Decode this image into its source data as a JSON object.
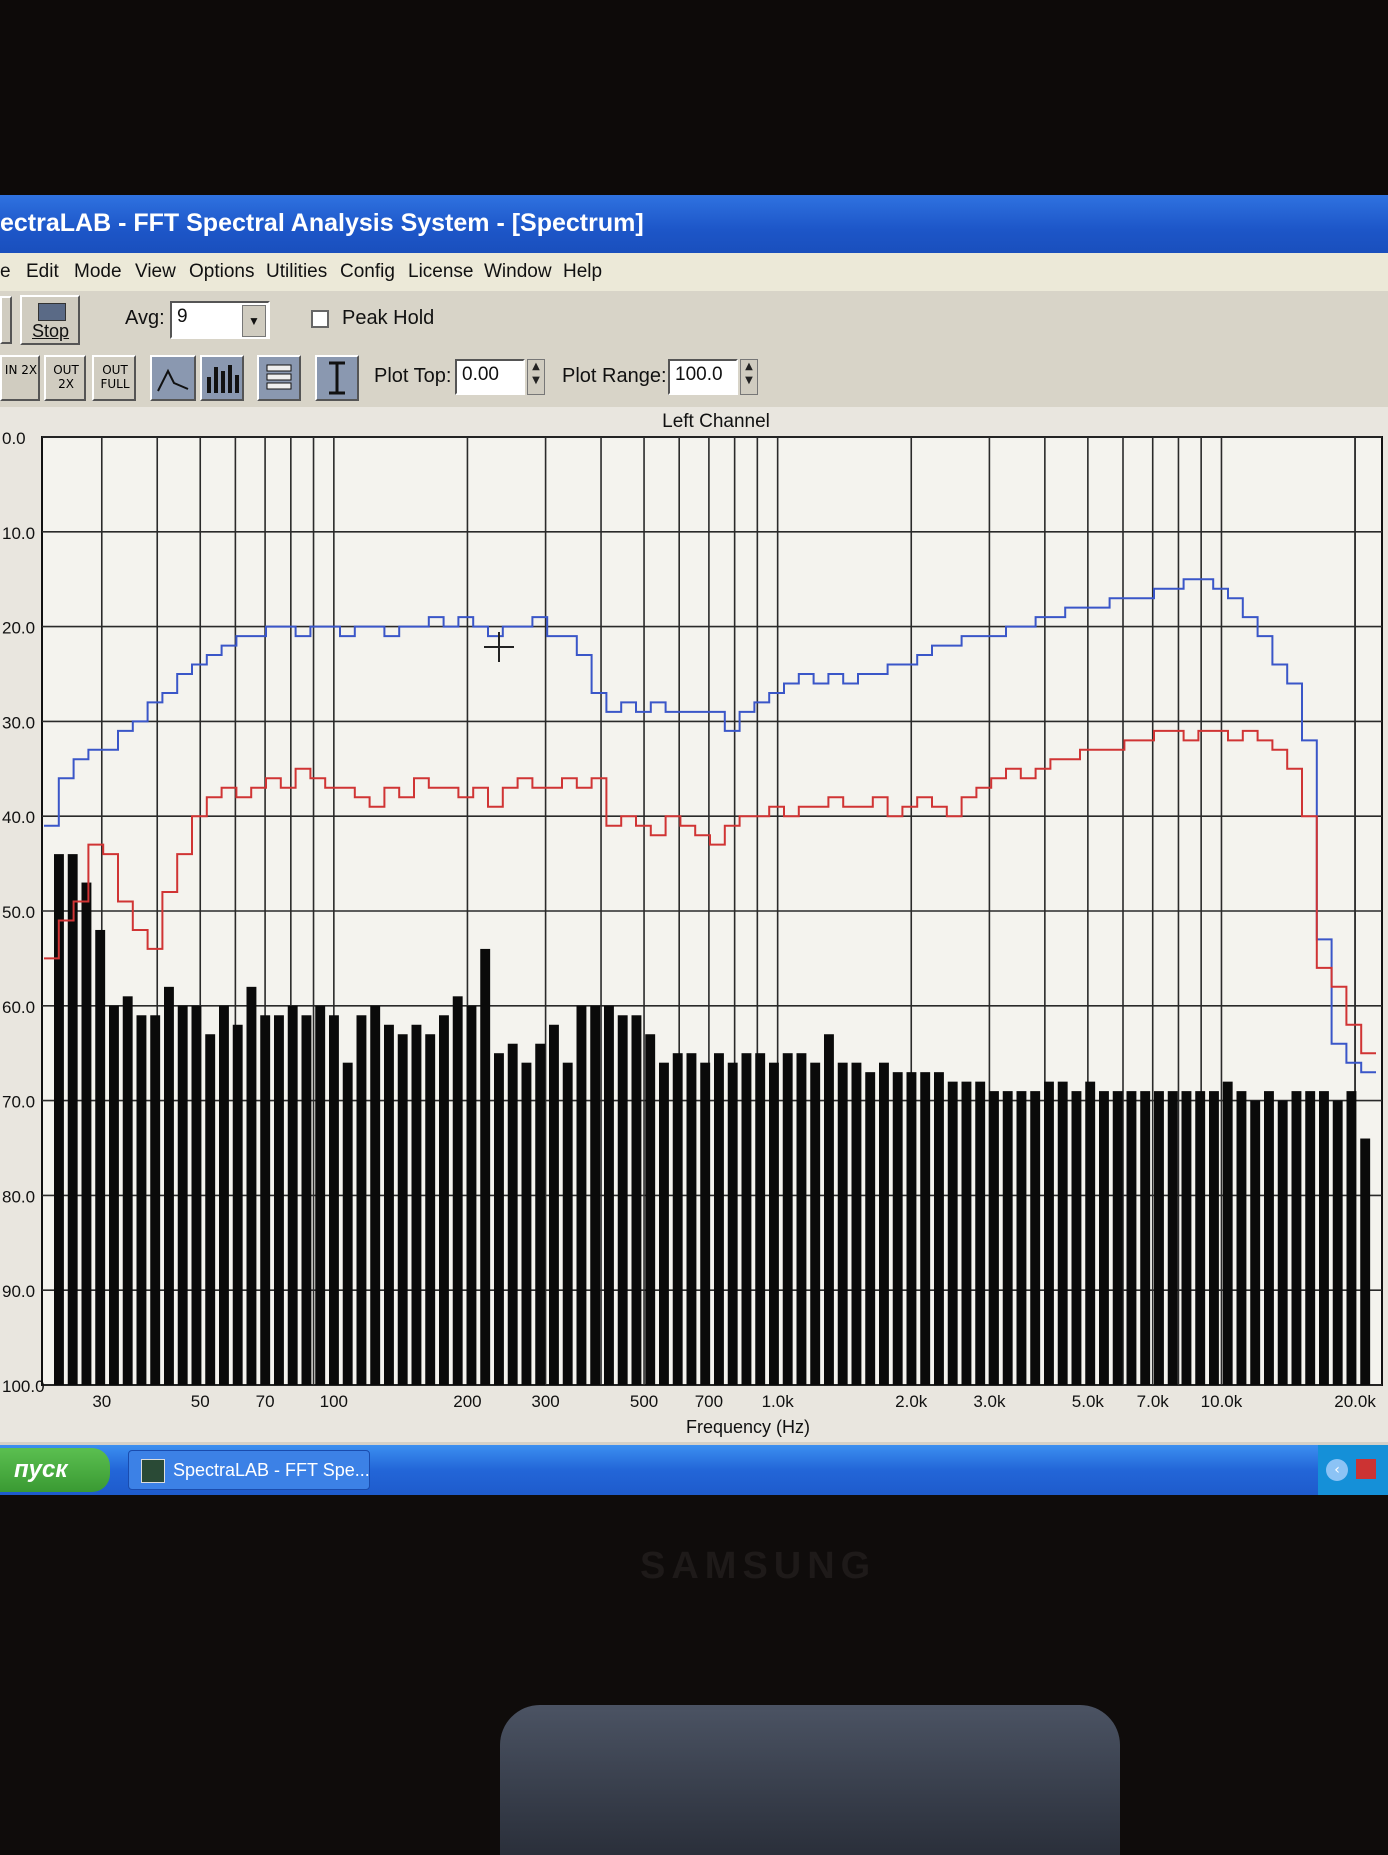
{
  "window": {
    "title": "ectraLAB - FFT Spectral Analysis System - [Spectrum]"
  },
  "menu": {
    "items": [
      "e",
      "Edit",
      "Mode",
      "View",
      "Options",
      "Utilities",
      "Config",
      "License",
      "Window",
      "Help"
    ]
  },
  "toolbar": {
    "stop_label": "Stop",
    "avg_label": "Avg:",
    "avg_value": "9",
    "peak_hold_label": "Peak Hold",
    "peak_hold_checked": false,
    "in_button": "IN 2X",
    "out2x_button": "OUT 2X",
    "outfull_button": "OUT FULL",
    "plot_top_label": "Plot Top:",
    "plot_top_value": "0.00",
    "plot_range_label": "Plot Range:",
    "plot_range_value": "100.0"
  },
  "taskbar": {
    "start_label": "пуск",
    "task_label": "SpectraLAB - FFT Spe..."
  },
  "monitor": {
    "brand": "SAMSUNG"
  },
  "chart_data": {
    "type": "bar",
    "title": "Left Channel",
    "xlabel": "Frequency (Hz)",
    "ylabel": "",
    "x_scale": "log",
    "xlim": [
      22,
      23000
    ],
    "ylim": [
      -100,
      0
    ],
    "y_tick_labels": [
      "0.0",
      "10.0",
      "20.0",
      "30.0",
      "40.0",
      "50.0",
      "60.0",
      "70.0",
      "80.0",
      "90.0",
      "100.0"
    ],
    "x_ticks": [
      {
        "value": 30,
        "label": "30"
      },
      {
        "value": 50,
        "label": "50"
      },
      {
        "value": 70,
        "label": "70"
      },
      {
        "value": 100,
        "label": "100"
      },
      {
        "value": 200,
        "label": "200"
      },
      {
        "value": 300,
        "label": "300"
      },
      {
        "value": 500,
        "label": "500"
      },
      {
        "value": 700,
        "label": "700"
      },
      {
        "value": 1000,
        "label": "1.0k"
      },
      {
        "value": 2000,
        "label": "2.0k"
      },
      {
        "value": 3000,
        "label": "3.0k"
      },
      {
        "value": 5000,
        "label": "5.0k"
      },
      {
        "value": 7000,
        "label": "7.0k"
      },
      {
        "value": 10000,
        "label": "10.0k"
      },
      {
        "value": 20000,
        "label": "20.0k"
      }
    ],
    "grid": true,
    "colors": {
      "bars": "#0a0a0a",
      "blue_line": "#3a56c8",
      "red_line": "#d03434",
      "background": "#f4f3ee",
      "grid": "#2a2a2a"
    },
    "bars": [
      -44,
      -44,
      -47,
      -52,
      -60,
      -59,
      -61,
      -61,
      -58,
      -60,
      -60,
      -63,
      -60,
      -62,
      -58,
      -61,
      -61,
      -60,
      -61,
      -60,
      -61,
      -66,
      -61,
      -60,
      -62,
      -63,
      -62,
      -63,
      -61,
      -59,
      -60,
      -54,
      -65,
      -64,
      -66,
      -64,
      -62,
      -66,
      -60,
      -60,
      -60,
      -61,
      -61,
      -63,
      -66,
      -65,
      -65,
      -66,
      -65,
      -66,
      -65,
      -65,
      -66,
      -65,
      -65,
      -66,
      -63,
      -66,
      -66,
      -67,
      -66,
      -67,
      -67,
      -67,
      -67,
      -68,
      -68,
      -68,
      -69,
      -69,
      -69,
      -69,
      -68,
      -68,
      -69,
      -68,
      -69,
      -69,
      -69,
      -69,
      -69,
      -69,
      -69,
      -69,
      -69,
      -68,
      -69,
      -70,
      -69,
      -70,
      -69,
      -69,
      -69,
      -70,
      -69,
      -74
    ],
    "series": [
      {
        "values": [
          -41,
          -36,
          -34,
          -33,
          -33,
          -31,
          -30,
          -28,
          -27,
          -25,
          -24,
          -23,
          -22,
          -21,
          -21,
          -20,
          -20,
          -21,
          -20,
          -20,
          -21,
          -20,
          -20,
          -21,
          -20,
          -20,
          -19,
          -20,
          -19,
          -20,
          -21,
          -20,
          -20,
          -19,
          -21,
          -21,
          -23,
          -27,
          -29,
          -28,
          -29,
          -28,
          -29,
          -29,
          -29,
          -29,
          -31,
          -29,
          -28,
          -27,
          -26,
          -25,
          -26,
          -25,
          -26,
          -25,
          -25,
          -24,
          -24,
          -23,
          -22,
          -22,
          -21,
          -21,
          -21,
          -20,
          -20,
          -19,
          -19,
          -18,
          -18,
          -18,
          -17,
          -17,
          -17,
          -16,
          -16,
          -15,
          -15,
          -16,
          -17,
          -19,
          -21,
          -24,
          -26,
          -32,
          -53,
          -64,
          -66,
          -67
        ]
      },
      {
        "values": [
          -55,
          -51,
          -49,
          -43,
          -44,
          -49,
          -52,
          -54,
          -48,
          -44,
          -40,
          -38,
          -37,
          -38,
          -37,
          -36,
          -37,
          -35,
          -36,
          -37,
          -37,
          -38,
          -39,
          -37,
          -38,
          -36,
          -37,
          -37,
          -38,
          -37,
          -39,
          -37,
          -36,
          -37,
          -37,
          -36,
          -37,
          -36,
          -41,
          -40,
          -41,
          -42,
          -40,
          -41,
          -42,
          -43,
          -41,
          -40,
          -40,
          -39,
          -40,
          -39,
          -39,
          -38,
          -39,
          -39,
          -38,
          -40,
          -39,
          -38,
          -39,
          -40,
          -38,
          -37,
          -36,
          -35,
          -36,
          -35,
          -34,
          -34,
          -33,
          -33,
          -33,
          -32,
          -32,
          -31,
          -31,
          -32,
          -31,
          -31,
          -32,
          -31,
          -32,
          -33,
          -35,
          -40,
          -56,
          -58,
          -62,
          -65
        ]
      }
    ]
  }
}
